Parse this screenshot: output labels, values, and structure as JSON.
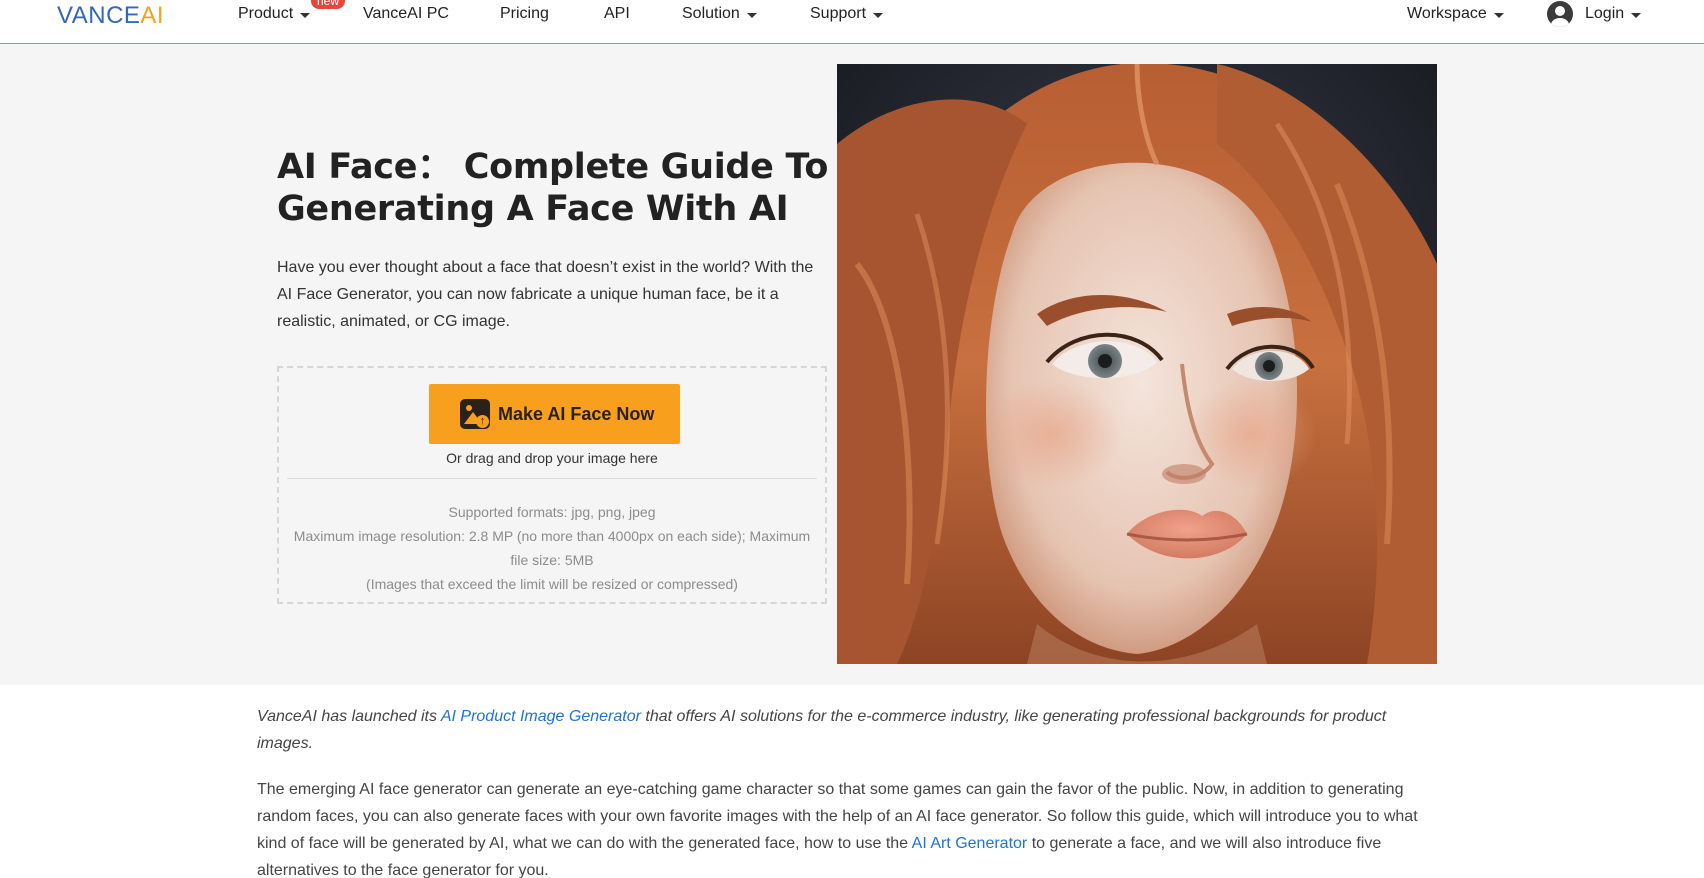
{
  "nav": {
    "logo_part1": "VANCE",
    "logo_part2": "AI",
    "items": [
      {
        "label": "Product",
        "has_caret": true
      },
      {
        "label": "VanceAI PC",
        "has_caret": false
      },
      {
        "label": "Pricing",
        "has_caret": false
      },
      {
        "label": "API",
        "has_caret": false
      },
      {
        "label": "Solution",
        "has_caret": true
      },
      {
        "label": "Support",
        "has_caret": true
      }
    ],
    "new_badge": "new",
    "workspace": "Workspace",
    "login": "Login"
  },
  "hero": {
    "title": "AI Face： Complete Guide To Generating A Face With AI",
    "description": "Have you ever thought about a face that doesn’t exist in the world? With the AI Face Generator, you can now fabricate a unique human face, be it a realistic, animated, or CG image.",
    "cta_label": "Make AI Face Now",
    "drag_hint": "Or drag and drop your image here",
    "formats": "Supported formats: jpg, png, jpeg",
    "resolution": "Maximum image resolution: 2.8 MP (no more than 4000px on each side); Maximum file size: 5MB",
    "limit_note": "(Images that exceed the limit will be resized or compressed)"
  },
  "content": {
    "p1_before": "VanceAI has launched its ",
    "p1_link": "AI Product Image Generator",
    "p1_after": " that offers AI solutions for the e-commerce industry, like generating professional backgrounds for product images.",
    "p2_before": "The emerging AI face generator can generate an eye-catching game character so that some games can gain the favor of the public. Now, in addition to generating random faces, you can also generate faces with your own favorite images with the help of an AI face generator. So follow this guide, which will introduce you to what kind of face will be generated by AI, what we can do with the generated face, how to use the ",
    "p2_link": "AI Art Generator",
    "p2_after": " to generate a face, and we will also introduce five alternatives to the face generator for you."
  },
  "colors": {
    "brand_blue": "#3567b7",
    "brand_orange": "#f5a020",
    "cta_orange": "#f8a01e",
    "link_blue": "#1d73d8",
    "badge_red": "#e8453c"
  },
  "icons": [
    "caret-down-icon",
    "user-circle-icon",
    "image-upload-icon"
  ]
}
